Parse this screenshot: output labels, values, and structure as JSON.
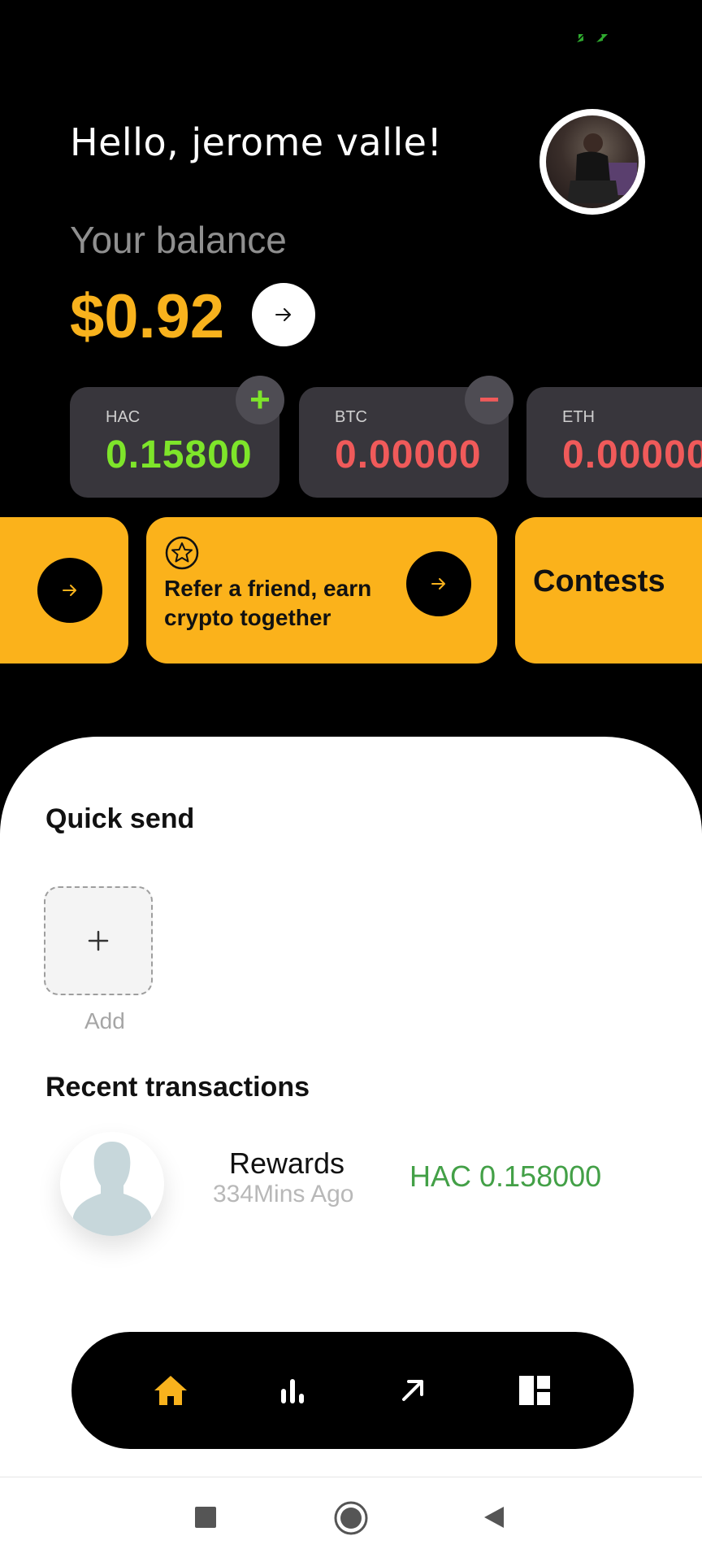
{
  "greeting": "Hello, jerome valle!",
  "balance": {
    "label": "Your balance",
    "value": "$0.92"
  },
  "coins": [
    {
      "symbol": "HAC",
      "amount": "0.15800",
      "color": "#7ee52a",
      "badge": "+"
    },
    {
      "symbol": "BTC",
      "amount": "0.00000",
      "color": "#f05a5a",
      "badge": "−"
    },
    {
      "symbol": "ETH",
      "amount": "0.00000",
      "color": "#f05a5a"
    }
  ],
  "promos": {
    "refer": "Refer a friend, earn crypto together",
    "contests": "Contests"
  },
  "quick_send": {
    "title": "Quick send",
    "add_label": "Add"
  },
  "recent": {
    "title": "Recent transactions",
    "items": [
      {
        "title": "Rewards",
        "time": "334Mins Ago",
        "amount": "HAC 0.158000"
      }
    ]
  },
  "nav": {
    "items": [
      "home-icon",
      "stats-icon",
      "send-icon",
      "dashboard-icon"
    ],
    "active": "home",
    "active_color": "#f8b21d"
  },
  "colors": {
    "accent": "#f8b21d",
    "positive": "#7ee52a",
    "negative": "#f05a5a",
    "reward": "#43a047"
  }
}
